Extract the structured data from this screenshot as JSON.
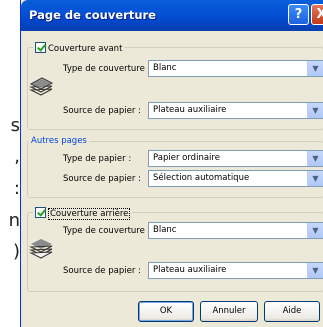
{
  "background_chars": [
    "s",
    ",",
    ":",
    "n",
    ")"
  ],
  "dialog": {
    "title": "Page de couverture",
    "help_label": "?",
    "close_label": "X"
  },
  "front_cover": {
    "checkbox_label": "Couverture avant",
    "checked": true,
    "cover_type_label": "Type de couverture :",
    "cover_type_value": "Blanc",
    "paper_source_label": "Source de papier :",
    "paper_source_value": "Plateau auxiliaire"
  },
  "other_pages": {
    "group_label": "Autres pages",
    "paper_type_label": "Type de papier :",
    "paper_type_value": "Papier ordinaire",
    "paper_source_label": "Source de papier :",
    "paper_source_value": "Sélection automatique"
  },
  "back_cover": {
    "checkbox_label": "Couverture arrière",
    "checked": true,
    "cover_type_label": "Type de couverture :",
    "cover_type_value": "Blanc",
    "paper_source_label": "Source de papier :",
    "paper_source_value": "Plateau auxiliaire"
  },
  "buttons": {
    "ok": "OK",
    "cancel": "Annuler",
    "help": "Aide"
  },
  "icons": {
    "dropdown": "chevron-down-icon",
    "paper_stack": "paper-stack-icon"
  }
}
